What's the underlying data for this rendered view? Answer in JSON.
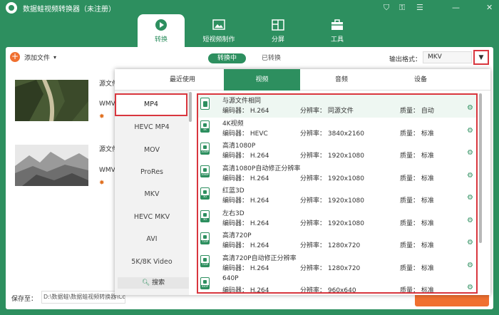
{
  "app": {
    "title": "数据蛙视频转换器（未注册）"
  },
  "window_controls": {
    "cart": "⛉",
    "key": "⚿",
    "menu": "☰",
    "minimize": "—",
    "close": "✕"
  },
  "nav": {
    "tabs": [
      {
        "label": "转换"
      },
      {
        "label": "短视频制作"
      },
      {
        "label": "分屏"
      },
      {
        "label": "工具"
      }
    ]
  },
  "toolbar": {
    "add_file": "添加文件",
    "add_arrow": "▾",
    "converting": "转换中",
    "converted": "已转换",
    "format_label": "输出格式：",
    "format_value": "MKV",
    "dropdown_arrow": "▼"
  },
  "files": [
    {
      "src_label": "源文件",
      "format": "WMV"
    },
    {
      "src_label": "源文件",
      "format": "WMV"
    }
  ],
  "bottom": {
    "save_label": "保存至：",
    "save_path": "D:\\数据蛙\\数据蛙视频转换器\\Converted"
  },
  "format_popup": {
    "tabs": [
      {
        "label": "最近使用"
      },
      {
        "label": "视频"
      },
      {
        "label": "音频"
      },
      {
        "label": "设备"
      }
    ],
    "formats": [
      "MP4",
      "HEVC MP4",
      "MOV",
      "ProRes",
      "MKV",
      "HEVC MKV",
      "AVI",
      "5K/8K Video"
    ],
    "search": "搜索",
    "presets": [
      {
        "name": "与源文件相同",
        "codec": "编码器：  H.264",
        "res": "分辨率：  同源文件",
        "quality": "质量：  自动",
        "badge": ""
      },
      {
        "name": "4K视频",
        "codec": "编码器：  HEVC",
        "res": "分辨率：  3840x2160",
        "quality": "质量：  标准",
        "badge": "4K"
      },
      {
        "name": "高清1080P",
        "codec": "编码器：  H.264",
        "res": "分辨率：  1920x1080",
        "quality": "质量：  标准",
        "badge": "1080P"
      },
      {
        "name": "高清1080P自动修正分辨率",
        "codec": "编码器：  H.264",
        "res": "分辨率：  1920x1080",
        "quality": "质量：  标准",
        "badge": "1080P"
      },
      {
        "name": "红蓝3D",
        "codec": "编码器：  H.264",
        "res": "分辨率：  1920x1080",
        "quality": "质量：  标准",
        "badge": "3D"
      },
      {
        "name": "左右3D",
        "codec": "编码器：  H.264",
        "res": "分辨率：  1920x1080",
        "quality": "质量：  标准",
        "badge": "3D"
      },
      {
        "name": "高清720P",
        "codec": "编码器：  H.264",
        "res": "分辨率：  1280x720",
        "quality": "质量：  标准",
        "badge": "720P"
      },
      {
        "name": "高清720P自动修正分辨率",
        "codec": "编码器：  H.264",
        "res": "分辨率：  1280x720",
        "quality": "质量：  标准",
        "badge": "720P"
      },
      {
        "name": "640P",
        "codec": "编码器：  H.264",
        "res": "分辨率：  960x640",
        "quality": "质量：  标准",
        "badge": "640P"
      }
    ],
    "gear": "⚙"
  },
  "colors": {
    "brand": "#2d8f5f",
    "accent": "#f07030",
    "highlight": "#d9363e"
  }
}
